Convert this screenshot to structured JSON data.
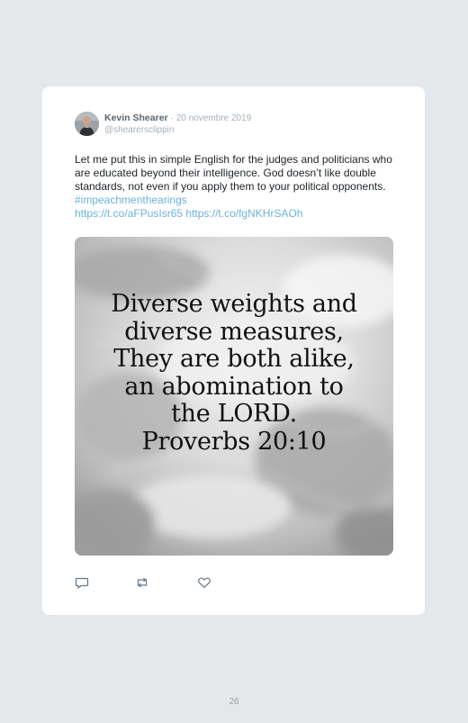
{
  "tweet": {
    "author_name": "Kevin Shearer",
    "separator": "·",
    "date": "20 novembre 2019",
    "handle": "@shearersclippin",
    "text": "Let me put this in simple English for the judges and politicians who are educated beyond their intelligence. God doesn’t like double standards, not even if you apply them to your political opponents. ",
    "hashtag": "#impeachmenthearings",
    "link1": "https://t.co/aFPusIsr65",
    "link2": "https://t.co/fgNKHrSAOh",
    "media": {
      "lines": [
        "Diverse weights and",
        "diverse measures,",
        "They are both alike,",
        "an abomination to",
        "the LORD.",
        "Proverbs 20:10"
      ]
    },
    "actions": {
      "reply_icon": "reply-icon",
      "retweet_icon": "retweet-icon",
      "like_icon": "heart-icon"
    }
  },
  "page": {
    "number": "26"
  },
  "colors": {
    "background": "#e5e8eb",
    "card": "#ffffff",
    "link": "#6cb3d8",
    "muted": "#a8b0b7",
    "icon": "#657786"
  }
}
